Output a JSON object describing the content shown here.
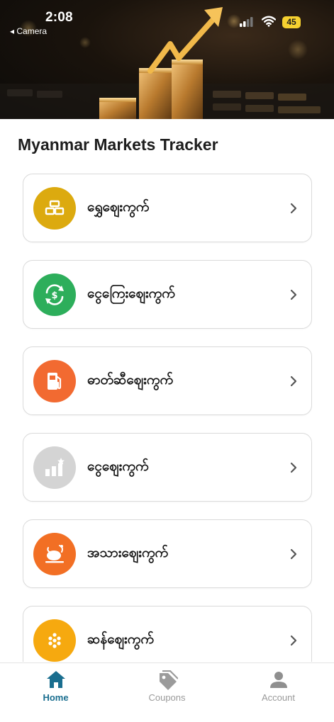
{
  "status_bar": {
    "time": "2:08",
    "back_label": "◂ Camera",
    "battery": "45"
  },
  "header": {
    "title": "Myanmar Markets Tracker"
  },
  "markets": [
    {
      "label": "ရွှေဈေးကွက်",
      "icon": "gold-bars-icon",
      "color": "#dcaa0f"
    },
    {
      "label": "ငွေကြေးဈေးကွက်",
      "icon": "currency-exchange-icon",
      "color": "#2dae5b"
    },
    {
      "label": "ဓာတ်ဆီဈေးကွက်",
      "icon": "fuel-pump-icon",
      "color": "#f26a31"
    },
    {
      "label": "ငွေဈေးကွက်",
      "icon": "silver-chart-icon",
      "color": "#d4d4d4"
    },
    {
      "label": "အသားဈေးကွက်",
      "icon": "meat-icon",
      "color": "#f26f24"
    },
    {
      "label": "ဆန်ဈေးကွက်",
      "icon": "rice-icon",
      "color": "#f6a90f"
    }
  ],
  "nav": {
    "home": "Home",
    "coupons": "Coupons",
    "account": "Account",
    "active_color": "#1a6e8f"
  }
}
